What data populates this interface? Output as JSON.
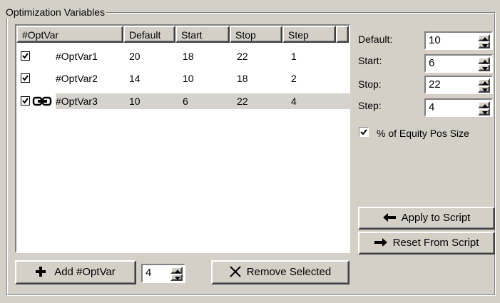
{
  "group_title": "Optimization Variables",
  "list": {
    "headers": [
      "#OptVar",
      "Default",
      "Start",
      "Stop",
      "Step"
    ],
    "rows": [
      {
        "checked": true,
        "linked": false,
        "name": "#OptVar1",
        "default": "20",
        "start": "18",
        "stop": "22",
        "step": "1",
        "selected": false
      },
      {
        "checked": true,
        "linked": false,
        "name": "#OptVar2",
        "default": "14",
        "start": "10",
        "stop": "18",
        "step": "2",
        "selected": false
      },
      {
        "checked": true,
        "linked": true,
        "name": "#OptVar3",
        "default": "10",
        "start": "6",
        "stop": "22",
        "step": "4",
        "selected": true
      }
    ]
  },
  "fields": {
    "default_label": "Default:",
    "default_value": "10",
    "start_label": "Start:",
    "start_value": "6",
    "stop_label": "Stop:",
    "stop_value": "22",
    "step_label": "Step:",
    "step_value": "4"
  },
  "equity_checkbox": {
    "label": "% of Equity Pos Size",
    "checked": true
  },
  "buttons": {
    "apply": "Apply to Script",
    "reset": "Reset From Script",
    "add": "Add #OptVar",
    "remove": "Remove Selected"
  },
  "add_count": "4"
}
